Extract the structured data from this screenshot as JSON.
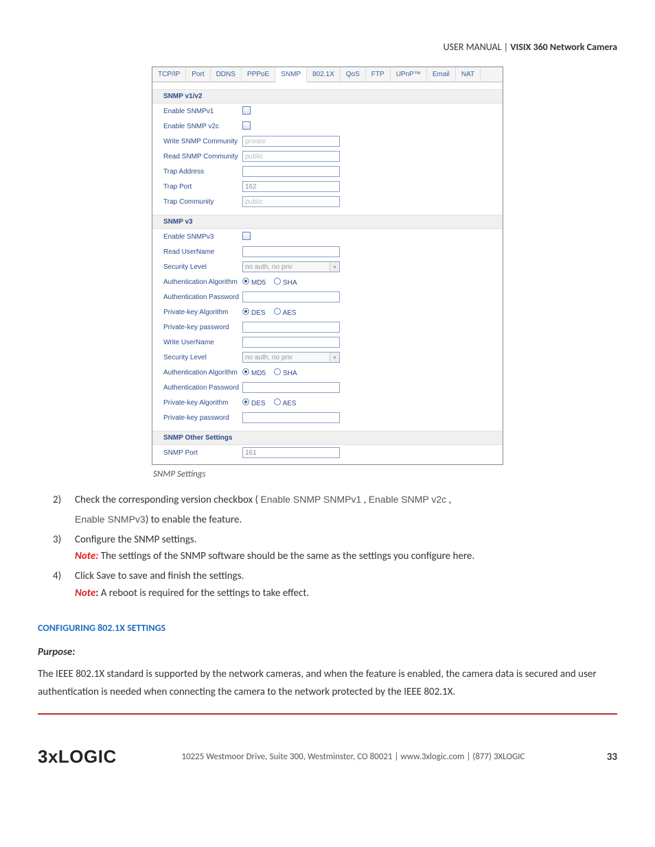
{
  "header": {
    "left": "USER MANUAL | ",
    "bold": "VISIX 360 Network Camera"
  },
  "tabs": [
    "TCP/IP",
    "Port",
    "DDNS",
    "PPPoE",
    "SNMP",
    "802.1X",
    "QoS",
    "FTP",
    "UPnP™",
    "Email",
    "NAT"
  ],
  "selected_tab": "SNMP",
  "snmp12": {
    "title": "SNMP v1/v2",
    "rows": {
      "enable_v1": "Enable SNMPv1",
      "enable_v2c": "Enable SNMP v2c",
      "write_comm": "Write SNMP Community",
      "write_comm_val": "private",
      "read_comm": "Read SNMP Community",
      "read_comm_val": "public",
      "trap_addr": "Trap Address",
      "trap_port": "Trap Port",
      "trap_port_val": "162",
      "trap_comm": "Trap Community",
      "trap_comm_val": "public"
    }
  },
  "snmp3": {
    "title": "SNMP v3",
    "rows": {
      "enable_v3": "Enable SNMPv3",
      "read_user": "Read UserName",
      "sec_level": "Security Level",
      "sec_level_val": "no auth, no priv",
      "auth_algo": "Authentication Algorithm",
      "md5": "MD5",
      "sha": "SHA",
      "auth_pw": "Authentication Password",
      "pk_algo": "Private-key Algorithm",
      "des": "DES",
      "aes": "AES",
      "pk_pw": "Private-key password",
      "write_user": "Write UserName"
    }
  },
  "other": {
    "title": "SNMP Other Settings",
    "snmp_port": "SNMP Port",
    "snmp_port_val": "161"
  },
  "caption": "SNMP Settings",
  "steps": {
    "s2": {
      "num": "2)",
      "text_a": "Check the corresponding version checkbox ( ",
      "ui1": "Enable SNMP SNMPv1",
      "comma": " , ",
      "ui2": "Enable SNMP v2c",
      "trail": " ,",
      "ui3": "Enable SNMPv3",
      "text_b": ") to enable the feature."
    },
    "s3": {
      "num": "3)",
      "text": "Configure the SNMP settings.",
      "note_label": "Note:",
      "note_text": " The settings of the SNMP software should be the same as the settings you configure here."
    },
    "s4": {
      "num": "4)",
      "text": "Click Save to save and finish the settings.",
      "note_label": "Note",
      "note_colon": ":",
      "note_text": " A reboot is required for the settings to take effect."
    }
  },
  "section_title": "CONFIGURING 802.1X SETTINGS",
  "purpose_label": "Purpose:",
  "purpose_text": "The IEEE 802.1X standard is supported by the network cameras, and when the feature is enabled, the camera data is secured and user authentication is needed when connecting the camera to the network protected by the IEEE 802.1X.",
  "footer": {
    "logo": "3xLOGIC",
    "addr": "10225 Westmoor Drive, Suite 300, Westminster, CO 80021 | www.3xlogic.com | (877) 3XLOGIC",
    "page": "33"
  }
}
